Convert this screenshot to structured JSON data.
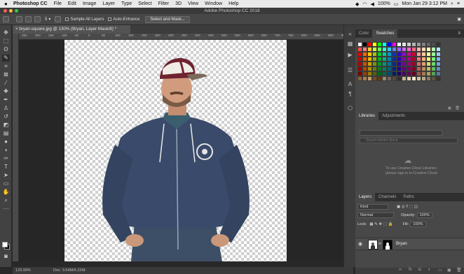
{
  "menubar": {
    "apple": "",
    "app": "Photoshop CC",
    "items": [
      "File",
      "Edit",
      "Image",
      "Layer",
      "Type",
      "Select",
      "Filter",
      "3D",
      "View",
      "Window",
      "Help"
    ],
    "battery": "100%",
    "clock": "Mon Jan 29  3:12 PM"
  },
  "window": {
    "title": "Adobe Photoshop CC 2018"
  },
  "options": {
    "brush_size": "5",
    "sample_all_layers": "Sample All Layers",
    "auto_enhance": "Auto-Enhance",
    "select_mask": "Select and Mask..."
  },
  "document": {
    "tab": "bryan-square.jpg @ 130% (Bryan, Layer Mask/8) *",
    "ruler_marks": [
      "250",
      "200",
      "150",
      "100",
      "50",
      "0",
      "50",
      "100",
      "150",
      "200",
      "250",
      "300",
      "350",
      "400",
      "450",
      "500",
      "550",
      "600",
      "650",
      "700",
      "750",
      "800",
      "850",
      "900",
      "950"
    ],
    "zoom": "129.99%",
    "doc_size": "Doc: 3.54M/4.22M"
  },
  "panels": {
    "color_tabs": [
      "Color",
      "Swatches"
    ],
    "library_tabs": [
      "Libraries",
      "Adjustments"
    ],
    "library_search": "Search Adobe Stock",
    "library_message": "To use Creative Cloud Libraries, please sign in to Creative Cloud",
    "layers_tabs": [
      "Layers",
      "Channels",
      "Paths"
    ],
    "kind": "Kind",
    "blend": "Normal",
    "opacity_label": "Opacity:",
    "opacity": "100%",
    "lock_label": "Lock:",
    "fill_label": "Fill:",
    "fill": "100%",
    "layer_name": "Bryan"
  },
  "swatch_colors": [
    "#ffffff",
    "#000000",
    "#ff0000",
    "#ffff00",
    "#00ff00",
    "#00ffff",
    "#0000ff",
    "#ff00ff",
    "#ffffff",
    "#e6e6e6",
    "#cccccc",
    "#b3b3b3",
    "#999999",
    "#808080",
    "#666666",
    "#4d4d4d",
    "#333333",
    "#ff4d4d",
    "#ff8080",
    "#ffcc33",
    "#ccff33",
    "#66ff66",
    "#33ffcc",
    "#33ccff",
    "#6680ff",
    "#9966ff",
    "#cc66ff",
    "#ff66cc",
    "#ff6680",
    "#ffb3b3",
    "#ffd9b3",
    "#ffffb3",
    "#b3ffb3",
    "#b3e6ff",
    "#e60000",
    "#ff6600",
    "#ffcc00",
    "#99cc00",
    "#00cc33",
    "#00cc99",
    "#0099cc",
    "#0033cc",
    "#3300cc",
    "#9900cc",
    "#cc0099",
    "#cc0033",
    "#ff9999",
    "#ffcc99",
    "#ffff99",
    "#99ff99",
    "#99ccff",
    "#cc0000",
    "#e65c00",
    "#e6b800",
    "#86b300",
    "#00b32d",
    "#00b386",
    "#0086b3",
    "#002db3",
    "#2d00b3",
    "#8600b3",
    "#b30086",
    "#b3002d",
    "#f27979",
    "#f2b379",
    "#f2f279",
    "#79f279",
    "#79b3f2",
    "#b30000",
    "#cc5200",
    "#cca300",
    "#739900",
    "#00992a",
    "#009973",
    "#007399",
    "#002a99",
    "#2a0099",
    "#730099",
    "#990073",
    "#99002a",
    "#d96c6c",
    "#d9a26c",
    "#d9d96c",
    "#6cd96c",
    "#6ca2d9",
    "#990000",
    "#b34700",
    "#b38f00",
    "#608000",
    "#008023",
    "#008060",
    "#006080",
    "#002380",
    "#230080",
    "#600080",
    "#800060",
    "#800023",
    "#bf5f5f",
    "#bf8f5f",
    "#bfbf5f",
    "#5fbf5f",
    "#5f8fbf",
    "#800000",
    "#993d00",
    "#997a00",
    "#4d6600",
    "#00661c",
    "#00664d",
    "#004d66",
    "#001c66",
    "#1c0066",
    "#4d0066",
    "#66004d",
    "#66001c",
    "#a65353",
    "#a67c53",
    "#a6a653",
    "#53a653",
    "#537ca6",
    "#8c6239",
    "#a67c52",
    "#c69c6d",
    "#754c24",
    "#603913",
    "#998675",
    "#736357",
    "#534741",
    "#362f2d",
    "#c7b299",
    "#e0cfb1",
    "#f5e6cc",
    "#d1c2a3",
    "#b8a78a",
    "#8a7a5f",
    "#5e5240",
    "#3c3426"
  ]
}
